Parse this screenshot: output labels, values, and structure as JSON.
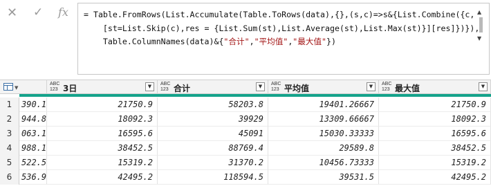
{
  "formula_bar": {
    "cancel_icon": "close-icon",
    "commit_icon": "check-icon",
    "fx_label": "fx",
    "lines": [
      "= Table.FromRows(List.Accumulate(Table.ToRows(data),{},(s,c)=>s&{List.Combine({c,",
      "    [st=List.Skip(c),res = {List.Sum(st),List.Average(st),List.Max(st)}][res]})}),",
      "    Table.ColumnNames(data)&{\"合计\",\"平均值\",\"最大值\"})"
    ]
  },
  "grid": {
    "columns": [
      {
        "type_top": "ABC",
        "type_bottom": "123",
        "name": "3日"
      },
      {
        "type_top": "ABC",
        "type_bottom": "123",
        "name": "合计"
      },
      {
        "type_top": "ABC",
        "type_bottom": "123",
        "name": "平均值"
      },
      {
        "type_top": "ABC",
        "type_bottom": "123",
        "name": "最大值"
      }
    ],
    "rows": [
      {
        "num": "1",
        "partial": "390.1",
        "cells": [
          "21750.9",
          "58203.8",
          "19401.26667",
          "21750.9"
        ]
      },
      {
        "num": "2",
        "partial": "944.8",
        "cells": [
          "18092.3",
          "39929",
          "13309.66667",
          "18092.3"
        ]
      },
      {
        "num": "3",
        "partial": "063.1",
        "cells": [
          "16595.6",
          "45091",
          "15030.33333",
          "16595.6"
        ]
      },
      {
        "num": "4",
        "partial": "988.1",
        "cells": [
          "38452.5",
          "88769.4",
          "29589.8",
          "38452.5"
        ]
      },
      {
        "num": "5",
        "partial": "522.5",
        "cells": [
          "15319.2",
          "31370.2",
          "10456.73333",
          "15319.2"
        ]
      },
      {
        "num": "6",
        "partial": "536.9",
        "cells": [
          "42495.2",
          "118594.5",
          "39531.5",
          "42495.2"
        ]
      }
    ]
  }
}
